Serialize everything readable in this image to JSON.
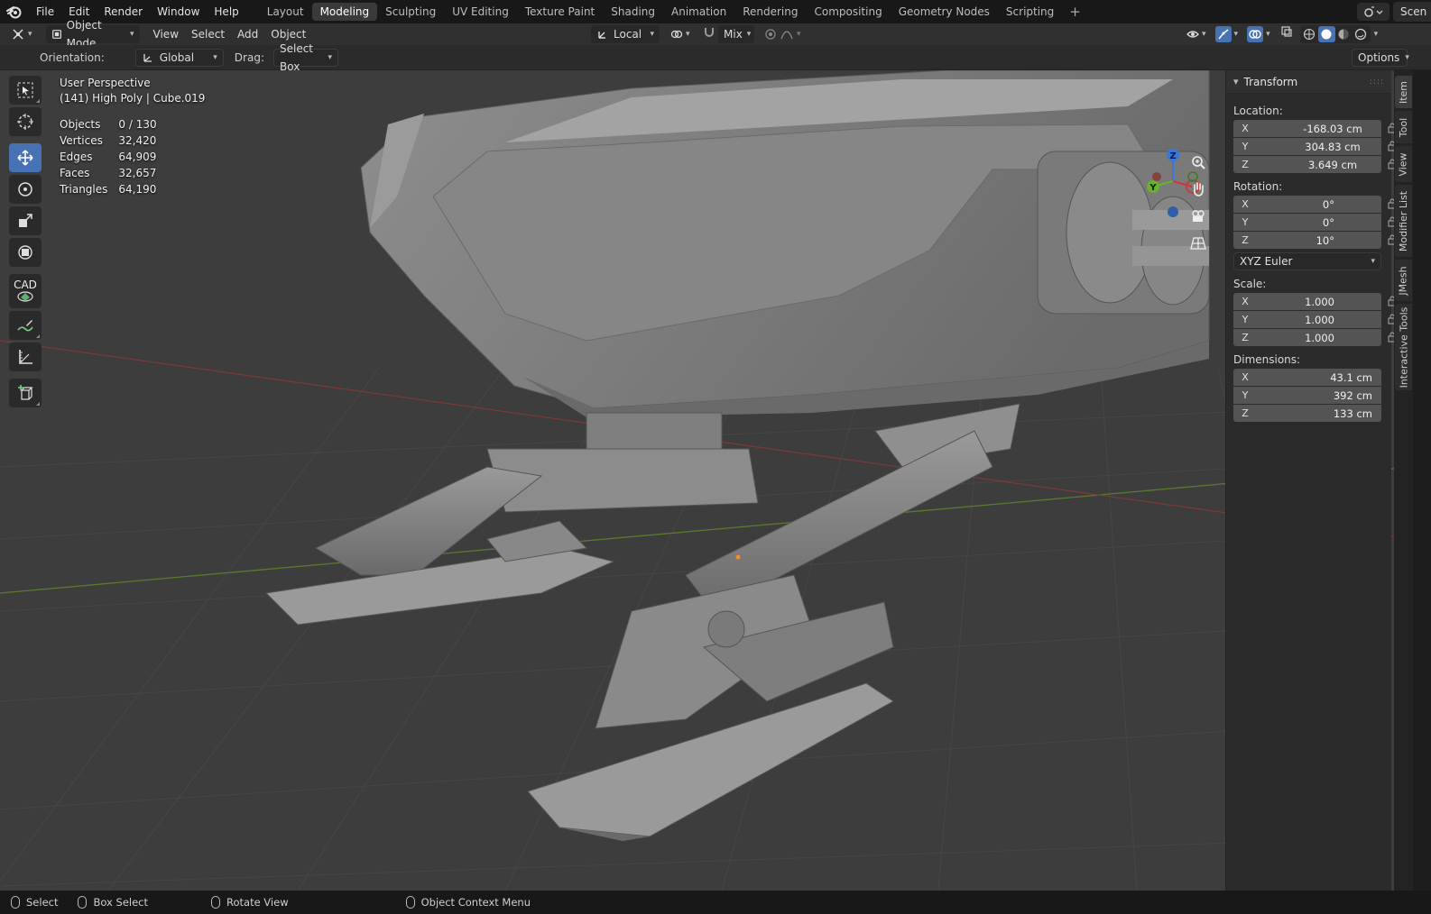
{
  "menubar": {
    "items": [
      "File",
      "Edit",
      "Render",
      "Window",
      "Help"
    ],
    "workspaces": [
      "Layout",
      "Modeling",
      "Sculpting",
      "UV Editing",
      "Texture Paint",
      "Shading",
      "Animation",
      "Rendering",
      "Compositing",
      "Geometry Nodes",
      "Scripting"
    ],
    "active_workspace": "Modeling",
    "add_icon": "+",
    "scene_label": "Scen"
  },
  "header": {
    "mode": "Object Mode",
    "menus": [
      "View",
      "Select",
      "Add",
      "Object"
    ],
    "transform_pivot": "Local",
    "snap_mode": "Mix"
  },
  "tool_settings": {
    "orientation_label": "Orientation:",
    "orientation_value": "Global",
    "drag_label": "Drag:",
    "drag_value": "Select Box",
    "options_label": "Options"
  },
  "overlay": {
    "perspective": "User Perspective",
    "object_info": "(141) High Poly | Cube.019",
    "stats": [
      {
        "label": "Objects",
        "value": "0 / 130"
      },
      {
        "label": "Vertices",
        "value": "32,420"
      },
      {
        "label": "Edges",
        "value": "64,909"
      },
      {
        "label": "Faces",
        "value": "32,657"
      },
      {
        "label": "Triangles",
        "value": "64,190"
      }
    ]
  },
  "toolbar": {
    "cad_label": "CAD"
  },
  "gizmo": {
    "x": "X",
    "y": "Y",
    "z": "Z"
  },
  "npanel": {
    "panel_title": "Transform",
    "location_label": "Location:",
    "location": [
      {
        "axis": "X",
        "value": "-168.03 cm"
      },
      {
        "axis": "Y",
        "value": "304.83 cm"
      },
      {
        "axis": "Z",
        "value": "3.649 cm"
      }
    ],
    "rotation_label": "Rotation:",
    "rotation": [
      {
        "axis": "X",
        "value": "0°"
      },
      {
        "axis": "Y",
        "value": "0°"
      },
      {
        "axis": "Z",
        "value": "10°"
      }
    ],
    "rotation_mode": "XYZ Euler",
    "scale_label": "Scale:",
    "scale": [
      {
        "axis": "X",
        "value": "1.000"
      },
      {
        "axis": "Y",
        "value": "1.000"
      },
      {
        "axis": "Z",
        "value": "1.000"
      }
    ],
    "dimensions_label": "Dimensions:",
    "dimensions": [
      {
        "axis": "X",
        "value": "43.1 cm"
      },
      {
        "axis": "Y",
        "value": "392 cm"
      },
      {
        "axis": "Z",
        "value": "133 cm"
      }
    ]
  },
  "sidetabs": [
    "Item",
    "Tool",
    "View",
    "Modifier List",
    "JMesh",
    "Interactive Tools"
  ],
  "statusbar": {
    "select": "Select",
    "box_select": "Box Select",
    "rotate_view": "Rotate View",
    "context_menu": "Object Context Menu"
  }
}
